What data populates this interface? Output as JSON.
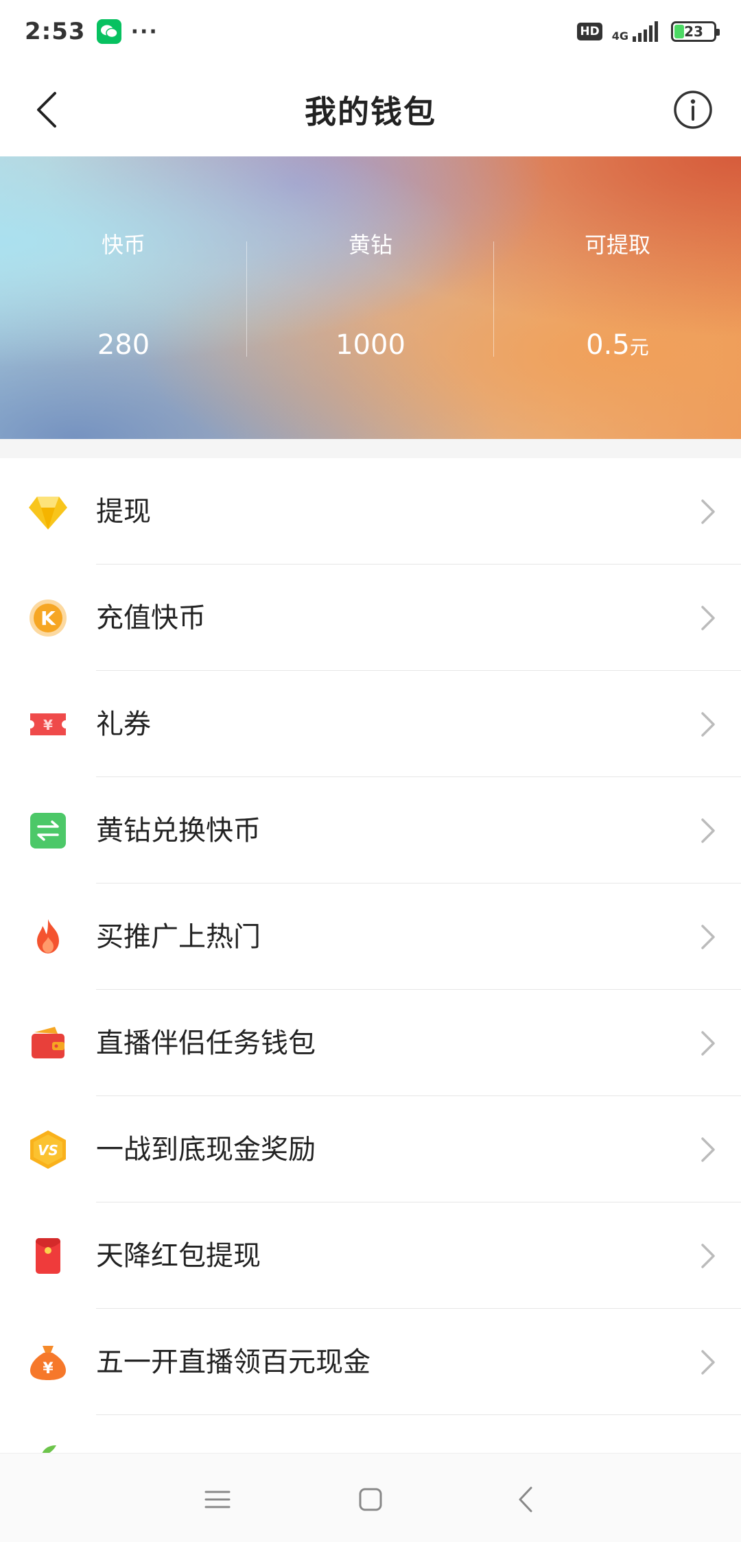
{
  "status_bar": {
    "time": "2:53",
    "dots": "···",
    "hd": "HD",
    "network": "4G",
    "battery": "23"
  },
  "nav": {
    "title": "我的钱包"
  },
  "wallet": {
    "stats": [
      {
        "label": "快币",
        "value": "280",
        "unit": ""
      },
      {
        "label": "黄钻",
        "value": "1000",
        "unit": ""
      },
      {
        "label": "可提取",
        "value": "0.5",
        "unit": "元"
      }
    ]
  },
  "menu": {
    "items": [
      {
        "label": "提现",
        "icon": "diamond-icon"
      },
      {
        "label": "充值快币",
        "icon": "k-coin-icon"
      },
      {
        "label": "礼券",
        "icon": "coupon-icon"
      },
      {
        "label": "黄钻兑换快币",
        "icon": "exchange-icon"
      },
      {
        "label": "买推广上热门",
        "icon": "flame-icon"
      },
      {
        "label": "直播伴侣任务钱包",
        "icon": "wallet-icon"
      },
      {
        "label": "一战到底现金奖励",
        "icon": "vs-icon"
      },
      {
        "label": "天降红包提现",
        "icon": "red-envelope-icon"
      },
      {
        "label": "五一开直播领百元现金",
        "icon": "money-bag-icon"
      }
    ]
  },
  "colors": {
    "accent_green": "#07c160",
    "separator": "#e6e6e6",
    "arrow": "#bbbbbb"
  }
}
